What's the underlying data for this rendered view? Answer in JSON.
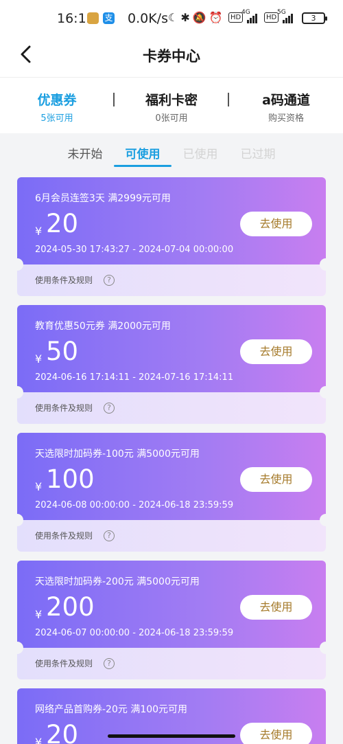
{
  "status_bar": {
    "time": "16:15",
    "speed": "0.0K/s",
    "battery": "3",
    "net1": "HD",
    "net1_gen": "4G",
    "net2": "HD",
    "net2_gen": "5G"
  },
  "header": {
    "title": "卡券中心"
  },
  "categories": [
    {
      "name": "优惠券",
      "sub": "5张可用"
    },
    {
      "name": "福利卡密",
      "sub": "0张可用"
    },
    {
      "name": "a码通道",
      "sub": "购买资格"
    }
  ],
  "status_tabs": [
    {
      "label": "未开始"
    },
    {
      "label": "可使用"
    },
    {
      "label": "已使用"
    },
    {
      "label": "已过期"
    }
  ],
  "coupons": [
    {
      "title": "6月会员连签3天 满2999元可用",
      "currency": "¥",
      "amount": "20",
      "date": "2024-05-30 17:43:27 - 2024-07-04 00:00:00",
      "button": "去使用",
      "rule": "使用条件及规则"
    },
    {
      "title": "教育优惠50元券 满2000元可用",
      "currency": "¥",
      "amount": "50",
      "date": "2024-06-16 17:14:11 - 2024-07-16 17:14:11",
      "button": "去使用",
      "rule": "使用条件及规则"
    },
    {
      "title": "天选限时加码券-100元 满5000元可用",
      "currency": "¥",
      "amount": "100",
      "date": "2024-06-08 00:00:00 - 2024-06-18 23:59:59",
      "button": "去使用",
      "rule": "使用条件及规则"
    },
    {
      "title": "天选限时加码券-200元 满5000元可用",
      "currency": "¥",
      "amount": "200",
      "date": "2024-06-07 00:00:00 - 2024-06-18 23:59:59",
      "button": "去使用",
      "rule": "使用条件及规则"
    },
    {
      "title": "网络产品首购券-20元 满100元可用",
      "currency": "¥",
      "amount": "20",
      "button": "去使用"
    }
  ],
  "colors": {
    "accent": "#1a9ee0",
    "coupon_gradient_start": "#7b6cf6",
    "coupon_gradient_end": "#c87ef0",
    "button_text": "#a57a2a"
  }
}
